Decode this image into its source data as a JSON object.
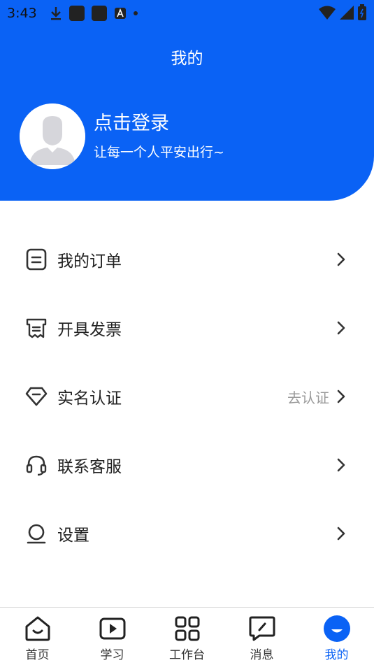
{
  "status_bar": {
    "time": "3:43",
    "icons": [
      "download-icon",
      "app-icon",
      "app-icon",
      "a-icon",
      "dot-icon",
      "wifi-icon",
      "signal-icon",
      "battery-icon"
    ]
  },
  "header": {
    "title": "我的",
    "background_color": "#0a62f5"
  },
  "profile": {
    "login_label": "点击登录",
    "slogan": "让每一个人平安出行~"
  },
  "menu": {
    "items": [
      {
        "label": "我的订单",
        "icon": "order-icon"
      },
      {
        "label": "开具发票",
        "icon": "invoice-icon"
      },
      {
        "label": "实名认证",
        "icon": "diamond-icon",
        "hint": "去认证"
      },
      {
        "label": "联系客服",
        "icon": "headset-icon"
      },
      {
        "label": "设置",
        "icon": "settings-icon"
      }
    ]
  },
  "bottom_nav": {
    "active_color": "#0a62f5",
    "items": [
      {
        "label": "首页",
        "icon": "home-icon"
      },
      {
        "label": "学习",
        "icon": "play-icon"
      },
      {
        "label": "工作台",
        "icon": "grid-icon"
      },
      {
        "label": "消息",
        "icon": "message-icon"
      },
      {
        "label": "我的",
        "icon": "profile-icon",
        "active": true
      }
    ]
  }
}
